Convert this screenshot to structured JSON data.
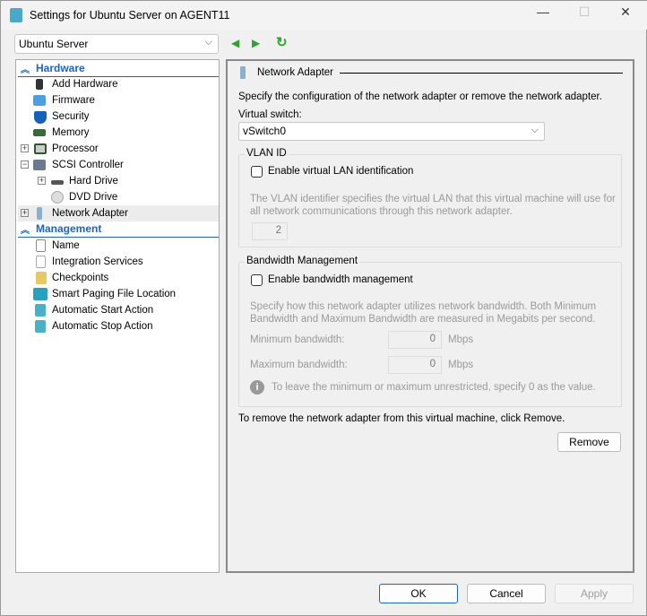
{
  "window": {
    "title": "Settings for Ubuntu Server on AGENT11"
  },
  "vm_selector": {
    "value": "Ubuntu Server"
  },
  "tree": {
    "hardware_header": "Hardware",
    "hardware": [
      {
        "label": "Add Hardware"
      },
      {
        "label": "Firmware"
      },
      {
        "label": "Security"
      },
      {
        "label": "Memory"
      },
      {
        "label": "Processor"
      },
      {
        "label": "SCSI Controller"
      },
      {
        "label": "Hard Drive"
      },
      {
        "label": "DVD Drive"
      },
      {
        "label": "Network Adapter"
      }
    ],
    "management_header": "Management",
    "management": [
      {
        "label": "Name"
      },
      {
        "label": "Integration Services"
      },
      {
        "label": "Checkpoints"
      },
      {
        "label": "Smart Paging File Location"
      },
      {
        "label": "Automatic Start Action"
      },
      {
        "label": "Automatic Stop Action"
      }
    ]
  },
  "panel": {
    "heading": "Network Adapter",
    "description": "Specify the configuration of the network adapter or remove the network adapter.",
    "switch_label": "Virtual switch:",
    "switch_value": "vSwitch0",
    "vlan": {
      "group": "VLAN ID",
      "checkbox": "Enable virtual LAN identification",
      "checked": false,
      "help": "The VLAN identifier specifies the virtual LAN that this virtual machine will use for all network communications through this network adapter.",
      "value": "2"
    },
    "bandwidth": {
      "group": "Bandwidth Management",
      "checkbox": "Enable bandwidth management",
      "checked": false,
      "help": "Specify how this network adapter utilizes network bandwidth. Both Minimum Bandwidth and Maximum Bandwidth are measured in Megabits per second.",
      "min_label": "Minimum bandwidth:",
      "min_value": "0",
      "max_label": "Maximum bandwidth:",
      "max_value": "0",
      "unit": "Mbps",
      "info": "To leave the minimum or maximum unrestricted, specify 0 as the value."
    },
    "remove_text": "To remove the network adapter from this virtual machine, click Remove.",
    "remove_button": "Remove"
  },
  "footer": {
    "ok": "OK",
    "cancel": "Cancel",
    "apply": "Apply"
  }
}
